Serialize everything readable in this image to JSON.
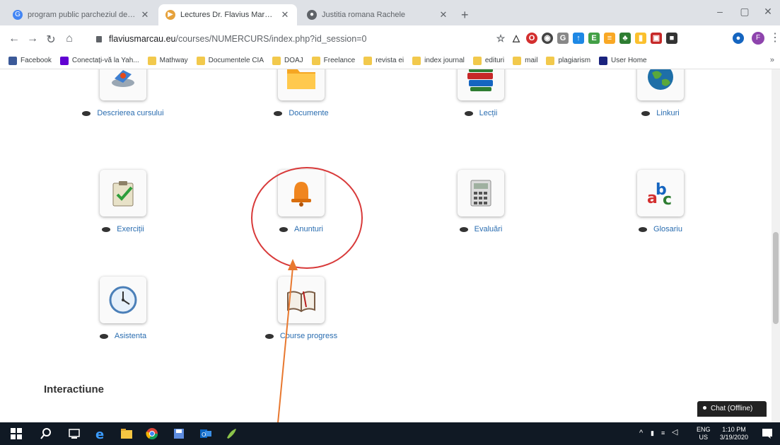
{
  "browser": {
    "tabs": [
      {
        "title": "program public parcheziul de pr",
        "favicon": "google-icon",
        "active": false
      },
      {
        "title": "Lectures Dr. Flavius Marcau - Co",
        "favicon": "site-icon",
        "active": true
      },
      {
        "title": "Justitia romana Rachele",
        "favicon": "globe-icon",
        "active": false
      }
    ],
    "new_tab": "+",
    "window_controls": {
      "minimize": "–",
      "maximize": "▢",
      "close": "✕"
    },
    "address": {
      "domain": "flaviusmarcau.eu",
      "path": "/courses/NUMERCURS/index.php?id_session=0"
    },
    "bookmarks": [
      {
        "label": "Facebook",
        "icon": "facebook-icon"
      },
      {
        "label": "Conectați-vă la Yah...",
        "icon": "mail-icon"
      },
      {
        "label": "Mathway",
        "icon": "folder-icon"
      },
      {
        "label": "Documentele CIA",
        "icon": "folder-icon"
      },
      {
        "label": "DOAJ",
        "icon": "folder-icon"
      },
      {
        "label": "Freelance",
        "icon": "folder-icon"
      },
      {
        "label": "revista ei",
        "icon": "folder-icon"
      },
      {
        "label": "index journal",
        "icon": "folder-icon"
      },
      {
        "label": "edituri",
        "icon": "folder-icon"
      },
      {
        "label": "mail",
        "icon": "folder-icon"
      },
      {
        "label": "plagiarism",
        "icon": "folder-icon"
      },
      {
        "label": "User Home",
        "icon": "user-home-icon"
      }
    ],
    "bookmarks_more": "»",
    "profile_initial": "F"
  },
  "tools": [
    {
      "label": "Descrierea cursului",
      "icon": "course-description-icon"
    },
    {
      "label": "Documente",
      "icon": "folder-icon"
    },
    {
      "label": "Lecții",
      "icon": "books-icon"
    },
    {
      "label": "Linkuri",
      "icon": "globe-icon"
    },
    {
      "label": "Exerciții",
      "icon": "exercise-checklist-icon"
    },
    {
      "label": "Anunturi",
      "icon": "bell-icon"
    },
    {
      "label": "Evaluări",
      "icon": "calculator-icon"
    },
    {
      "label": "Glosariu",
      "icon": "abc-icon"
    },
    {
      "label": "Asistenta",
      "icon": "clock-icon"
    },
    {
      "label": "Course progress",
      "icon": "open-book-icon"
    }
  ],
  "section": {
    "title": "Interactiune"
  },
  "chat": {
    "label": "Chat (Offline)"
  },
  "taskbar": {
    "lang": "ENG",
    "region": "US",
    "time": "1:10 PM",
    "date": "3/19/2020"
  },
  "colors": {
    "link": "#2a6db0",
    "annotation_circle": "#d83a3a",
    "annotation_arrow": "#e8782f",
    "taskbar": "#101924"
  }
}
